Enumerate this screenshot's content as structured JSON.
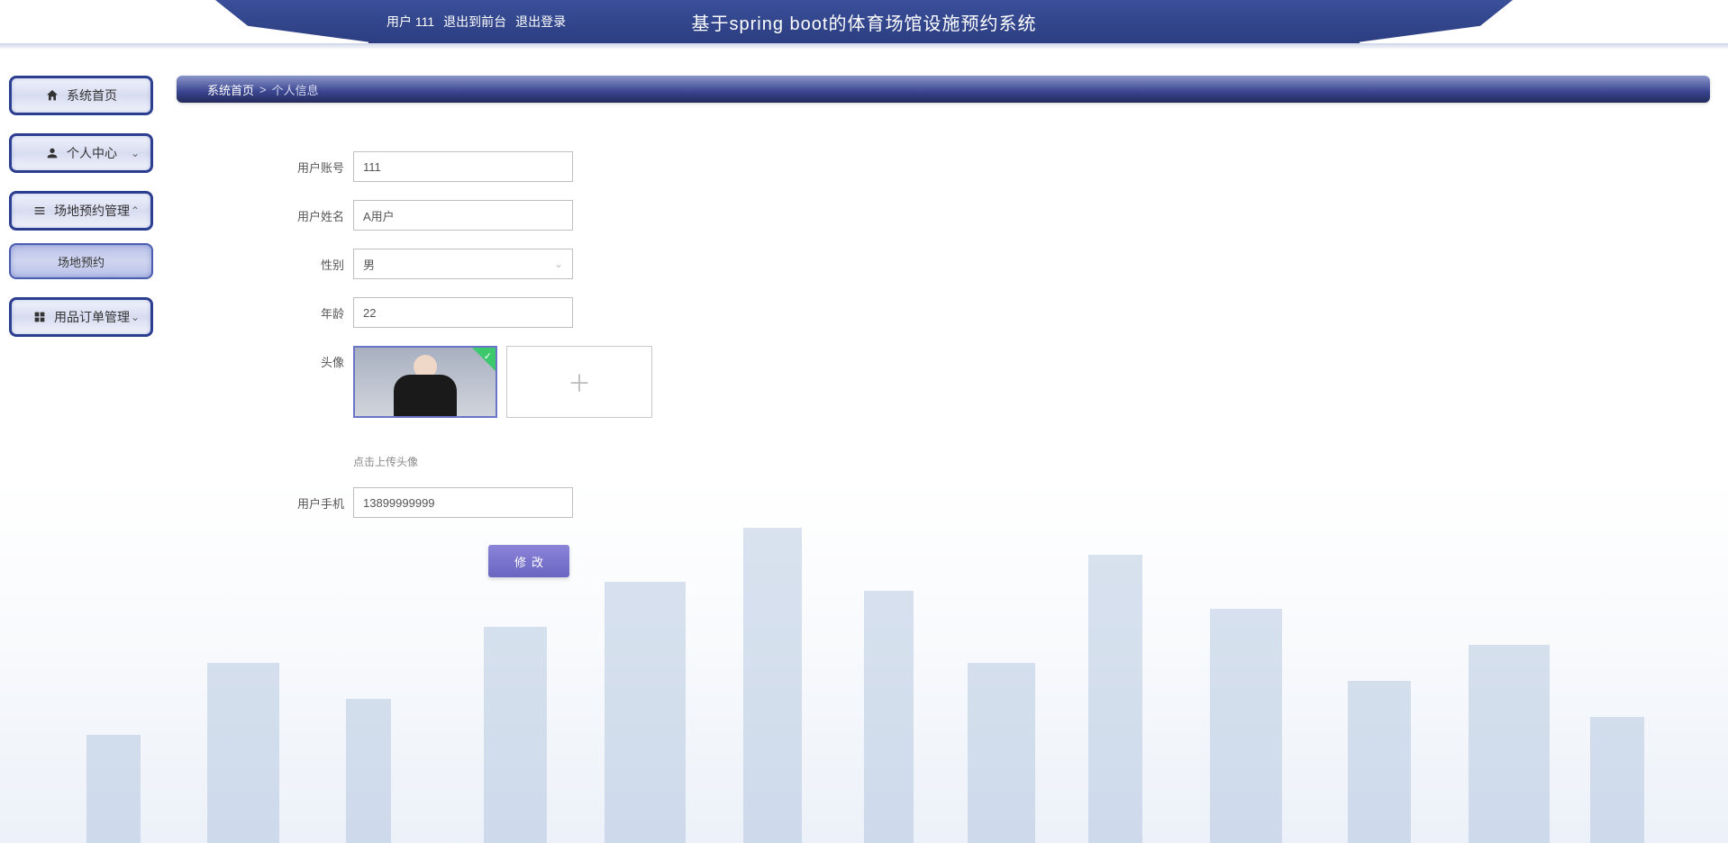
{
  "header": {
    "user_text": "用户 111",
    "back_to_front": "退出到前台",
    "logout": "退出登录",
    "title": "基于spring boot的体育场馆设施预约系统"
  },
  "sidebar": {
    "home": "系统首页",
    "personal": "个人中心",
    "venue_mgmt": "场地预约管理",
    "venue_booking": "场地预约",
    "order_mgmt": "用品订单管理"
  },
  "breadcrumb": {
    "home": "系统首页",
    "sep": ">",
    "current": "个人信息"
  },
  "form": {
    "labels": {
      "account": "用户账号",
      "name": "用户姓名",
      "gender": "性别",
      "age": "年龄",
      "avatar": "头像",
      "phone": "用户手机"
    },
    "values": {
      "account": "111",
      "name": "A用户",
      "gender": "男",
      "age": "22",
      "phone": "13899999999"
    },
    "avatar_hint": "点击上传头像",
    "submit": "修改"
  }
}
